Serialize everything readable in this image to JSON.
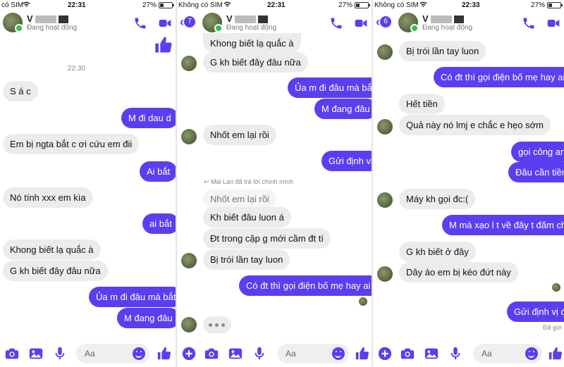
{
  "colors": {
    "accent": "#5b3ef0",
    "incoming": "#ececec",
    "online": "#31c24d"
  },
  "panel1": {
    "status": {
      "carrier": "có SIM",
      "time": "22:31",
      "battery": "27%",
      "battery_level": 0.27
    },
    "header": {
      "name": "V",
      "status": "Đang hoạt động"
    },
    "timestamp": "22:30",
    "messages": [
      {
        "dir": "in",
        "text": "S á c"
      },
      {
        "dir": "out",
        "text": "M đi dau d"
      },
      {
        "dir": "in",
        "text": "Em bị ngta bắt c ơi cứu em đii"
      },
      {
        "dir": "out",
        "text": "Ai bắt"
      },
      {
        "dir": "in",
        "text": "Nó tính xxx em kìa"
      },
      {
        "dir": "out",
        "text": "ai bắt"
      },
      {
        "dir": "in",
        "text": "Khong biết lạ quắc à"
      },
      {
        "dir": "in",
        "text": "G kh biết đây đâu nữa"
      },
      {
        "dir": "out",
        "text": "Ủa m đi đâu mà bắt"
      },
      {
        "dir": "out",
        "text": "M đang đâu"
      }
    ],
    "composer": {
      "placeholder": "Aa"
    }
  },
  "panel2": {
    "status": {
      "carrier": "Không có SIM",
      "time": "22:31",
      "battery": "27%",
      "battery_level": 0.27
    },
    "header": {
      "back_count": "7",
      "name": "V",
      "status": "Đang hoạt động"
    },
    "reply_note": "Mai Lan đã trả lời chính mình",
    "messages": [
      {
        "dir": "in",
        "text": "Khong biết lạ quắc à"
      },
      {
        "dir": "in",
        "text": "G kh biết đây đâu nữa"
      },
      {
        "dir": "out",
        "text": "Ủa m đi đâu mà bắt"
      },
      {
        "dir": "out",
        "text": "M đang đâu"
      },
      {
        "dir": "in",
        "text": "Nhốt em lại rồi"
      },
      {
        "dir": "out",
        "text": "Gửi định vị"
      },
      {
        "dir": "quoted",
        "text": "Nhốt em lại rồi"
      },
      {
        "dir": "in",
        "text": "Kh biết đâu luon á"
      },
      {
        "dir": "in",
        "text": "Đt trong cặp g mới cầm đt tí"
      },
      {
        "dir": "in",
        "text": "Bị trói lần tay luon"
      },
      {
        "dir": "out",
        "text": "Có đt thì gọi điện bố mẹ hay ai đi"
      }
    ],
    "composer": {
      "placeholder": "Aa"
    }
  },
  "panel3": {
    "status": {
      "carrier": "Không có SIM",
      "time": "22:33",
      "battery": "27%",
      "battery_level": 0.27
    },
    "header": {
      "back_count": "6",
      "name": "V",
      "status": "Đang hoạt động"
    },
    "messages": [
      {
        "dir": "in",
        "text": "Bị trói lần tay luon"
      },
      {
        "dir": "out",
        "text": "Có đt thì gọi điện bố mẹ hay ai đi"
      },
      {
        "dir": "in",
        "text": "Hết tiền"
      },
      {
        "dir": "in",
        "text": "Quả này nó lmj e chắc e hẹo sớm"
      },
      {
        "dir": "out",
        "text": "gọi công an"
      },
      {
        "dir": "out",
        "text": "Đâu cần tiền"
      },
      {
        "dir": "in",
        "text": "Máy kh gọi đc:("
      },
      {
        "dir": "out",
        "text": "M mà xạo l t về đây t đấm chết"
      },
      {
        "dir": "in",
        "text": "G kh biết ở đây"
      },
      {
        "dir": "in",
        "text": "Dây áo em bị kéo đứt này"
      },
      {
        "dir": "out",
        "text": "Gửi định vị đi"
      }
    ],
    "seen": "Đã gửi",
    "composer": {
      "placeholder": "Aa"
    }
  }
}
